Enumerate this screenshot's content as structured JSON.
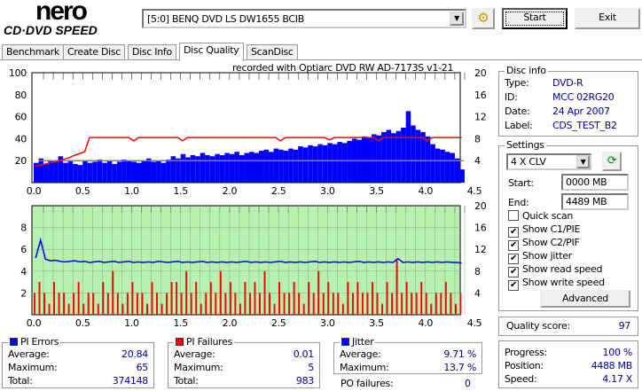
{
  "app": {
    "logo_top": "nero",
    "logo_bottom": "CD·DVD SPEED"
  },
  "toolbar": {
    "drive": "[5:0]  BENQ DVD LS DW1655 BCIB",
    "start": "Start",
    "exit": "Exit"
  },
  "tabs": [
    "Benchmark",
    "Create Disc",
    "Disc Info",
    "Disc Quality",
    "ScanDisc"
  ],
  "recorded_with": "recorded with Optiarc DVD RW AD-7173S  v1-21",
  "disc_info": {
    "title": "Disc info",
    "rows": [
      {
        "k": "Type:",
        "v": "DVD-R"
      },
      {
        "k": "ID:",
        "v": "MCC 02RG20"
      },
      {
        "k": "Date:",
        "v": "24 Apr 2007"
      },
      {
        "k": "Label:",
        "v": "CDS_TEST_B2"
      }
    ]
  },
  "settings": {
    "title": "Settings",
    "speed": "4 X CLV",
    "start_label": "Start:",
    "start_value": "0000 MB",
    "end_label": "End:",
    "end_value": "4489 MB",
    "checks": [
      {
        "label": "Quick scan",
        "checked": false
      },
      {
        "label": "Show C1/PIE",
        "checked": true
      },
      {
        "label": "Show C2/PIF",
        "checked": true
      },
      {
        "label": "Show jitter",
        "checked": true
      },
      {
        "label": "Show read speed",
        "checked": true
      },
      {
        "label": "Show write speed",
        "checked": true
      }
    ],
    "advanced": "Advanced"
  },
  "quality": {
    "label": "Quality score:",
    "value": "97"
  },
  "progress": {
    "rows": [
      {
        "k": "Progress:",
        "v": "100 %"
      },
      {
        "k": "Position:",
        "v": "4488 MB"
      },
      {
        "k": "Speed:",
        "v": "4.17 X"
      }
    ]
  },
  "pi_errors": {
    "title": "PI Errors",
    "color": "#0000ff",
    "rows": [
      {
        "k": "Average:",
        "v": "20.84"
      },
      {
        "k": "Maximum:",
        "v": "65"
      },
      {
        "k": "Total:",
        "v": "374148"
      }
    ]
  },
  "pi_failures": {
    "title": "PI Failures",
    "color": "#ff0000",
    "rows": [
      {
        "k": "Average:",
        "v": "0.01"
      },
      {
        "k": "Maximum:",
        "v": "5"
      },
      {
        "k": "Total:",
        "v": "983"
      }
    ]
  },
  "jitter": {
    "title": "Jitter",
    "color": "#0000ff",
    "rows": [
      {
        "k": "Average:",
        "v": "9.71 %"
      },
      {
        "k": "Maximum:",
        "v": "13.7 %"
      }
    ]
  },
  "po_failures": {
    "k": "PO failures:",
    "v": "0"
  },
  "chart_data": [
    {
      "type": "bar",
      "name": "PI errors / read speed",
      "xlim": [
        0,
        4.5
      ],
      "ylim": [
        0,
        100
      ],
      "y2lim": [
        0,
        20
      ],
      "x_ticks": [
        "0.0",
        "0.5",
        "1.0",
        "1.5",
        "2.0",
        "2.5",
        "3.0",
        "3.5",
        "4.0",
        "4.5"
      ],
      "y_ticks": [
        "20",
        "40",
        "60",
        "80",
        "100"
      ],
      "y2_ticks": [
        "4",
        "8",
        "12",
        "16",
        "20"
      ],
      "step": 0.05,
      "pi_errors": [
        18,
        22,
        17,
        20,
        19,
        24,
        18,
        20,
        17,
        16,
        20,
        18,
        19,
        21,
        18,
        20,
        17,
        19,
        21,
        20,
        19,
        18,
        20,
        22,
        19,
        20,
        18,
        21,
        24,
        22,
        26,
        23,
        25,
        24,
        27,
        25,
        24,
        26,
        25,
        27,
        26,
        28,
        25,
        27,
        28,
        27,
        29,
        30,
        28,
        31,
        30,
        29,
        31,
        30,
        33,
        32,
        34,
        33,
        35,
        34,
        36,
        35,
        37,
        36,
        38,
        40,
        39,
        42,
        41,
        44,
        43,
        46,
        48,
        45,
        47,
        50,
        65,
        52,
        48,
        46,
        42,
        35,
        31,
        30,
        28,
        27,
        22,
        12
      ],
      "read_speed": [
        3,
        3.2,
        3.4,
        3.6,
        3.8,
        4,
        4.3,
        4.6,
        5,
        5.3,
        5.6,
        8.2,
        8.2,
        8.2,
        8.2,
        8.2,
        8.2,
        8.2,
        8.2,
        8.2,
        7.6,
        8.2,
        8.2,
        8.2,
        8.2,
        8.2,
        8.2,
        8.2,
        8.2,
        8.2,
        7.6,
        8.2,
        8.2,
        8.2,
        8.2,
        8.2,
        8.2,
        8.2,
        8.2,
        8.2,
        8.2,
        8.2,
        8.2,
        8.2,
        8.2,
        8.2,
        8.2,
        8.2,
        8.2,
        8.2,
        7.6,
        8.2,
        8.2,
        8.2,
        8.2,
        8.2,
        8.2,
        8.2,
        8.2,
        8.2,
        7.8,
        8.2,
        8.2,
        8.2,
        8.2,
        8.2,
        8.2,
        8.2,
        8.2,
        8.2,
        7.6,
        8.2,
        8.2,
        8.2,
        8.2,
        8.2,
        8.2,
        8.2,
        8.2,
        8.2,
        7.6,
        8.2,
        8.2,
        8.2,
        8.2,
        8.2,
        8.2,
        8.2
      ],
      "write_speed": 4
    },
    {
      "type": "bar",
      "name": "PI failures / jitter",
      "xlim": [
        0,
        4.5
      ],
      "ylim": [
        0,
        10
      ],
      "y2lim": [
        0,
        20
      ],
      "x_ticks": [
        "0.0",
        "0.5",
        "1.0",
        "1.5",
        "2.0",
        "2.5",
        "3.0",
        "3.5",
        "4.0",
        "4.5"
      ],
      "y_ticks": [
        "2",
        "4",
        "6",
        "8"
      ],
      "y2_ticks": [
        "4",
        "8",
        "12",
        "16",
        "20"
      ],
      "step": 0.05,
      "pi_failures": [
        2,
        3,
        2,
        1,
        3,
        2,
        2,
        1,
        2,
        3,
        1,
        2,
        2,
        1,
        3,
        2,
        4,
        2,
        1,
        2,
        3,
        2,
        2,
        1,
        3,
        2,
        1,
        2,
        3,
        3,
        2,
        4,
        2,
        3,
        1,
        2,
        3,
        2,
        4,
        2,
        3,
        2,
        1,
        3,
        2,
        3,
        2,
        4,
        2,
        1,
        3,
        2,
        2,
        3,
        2,
        1,
        3,
        2,
        4,
        2,
        3,
        2,
        2,
        1,
        3,
        2,
        3,
        2,
        2,
        3,
        2,
        1,
        3,
        2,
        5,
        2,
        3,
        2,
        2,
        3,
        2,
        1,
        2,
        2,
        3,
        2,
        1,
        2
      ],
      "jitter": [
        10.4,
        13.7,
        10.2,
        9.9,
        10,
        9.8,
        9.7,
        9.8,
        9.9,
        9.7,
        9.8,
        9.6,
        9.7,
        9.8,
        9.6,
        9.7,
        9.8,
        9.6,
        9.7,
        9.8,
        9.6,
        9.7,
        9.6,
        9.7,
        9.6,
        9.8,
        9.7,
        9.6,
        9.7,
        9.8,
        9.6,
        9.7,
        9.6,
        9.7,
        9.8,
        9.6,
        9.7,
        9.6,
        9.7,
        9.6,
        9.7,
        9.6,
        9.7,
        9.8,
        9.6,
        9.7,
        9.6,
        9.7,
        9.6,
        9.7,
        9.8,
        9.6,
        9.7,
        9.6,
        9.7,
        9.6,
        9.7,
        9.8,
        9.6,
        9.7,
        9.6,
        9.7,
        9.6,
        9.7,
        9.6,
        9.7,
        9.8,
        9.6,
        9.7,
        9.6,
        9.7,
        9.6,
        9.7,
        9.6,
        10.3,
        9.6,
        9.7,
        9.6,
        9.7,
        9.6,
        9.7,
        9.6,
        9.7,
        9.6,
        9.7,
        9.6,
        9.6,
        9.5
      ]
    }
  ]
}
